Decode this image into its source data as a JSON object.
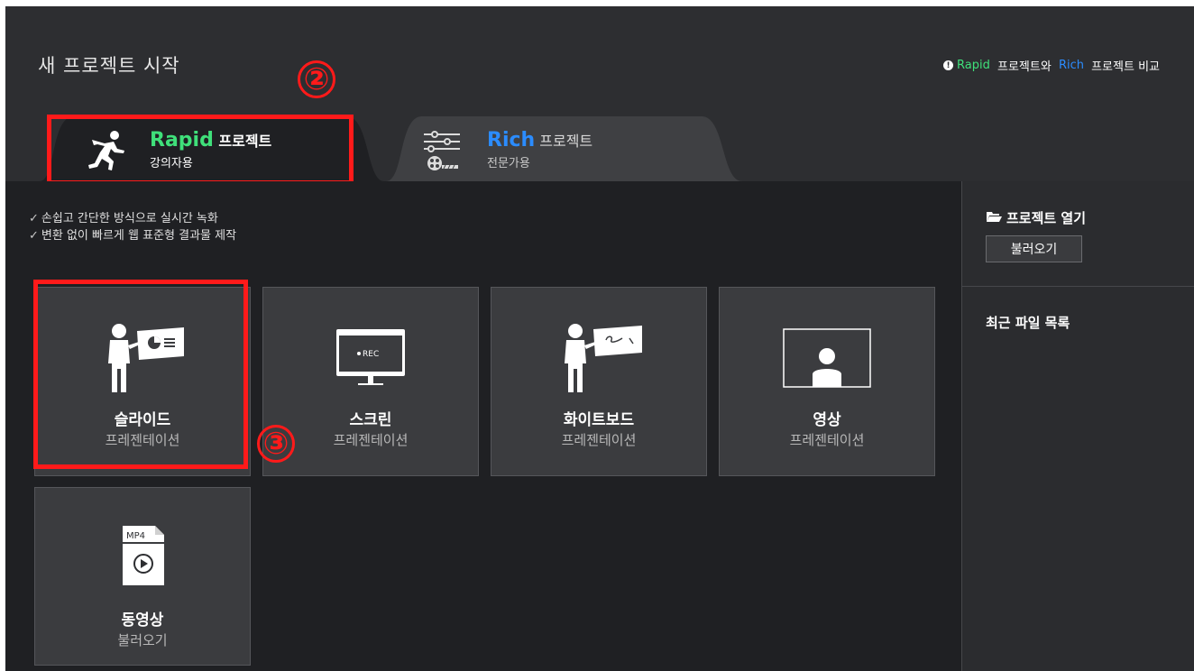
{
  "title": "새 프로젝트 시작",
  "compare": {
    "rapid": "Rapid",
    "mid": " 프로젝트와 ",
    "rich": "Rich",
    "tail": " 프로젝트 비교"
  },
  "tabs": {
    "rapid": {
      "name": "Rapid",
      "suffix": " 프로젝트",
      "sub": "강의자용"
    },
    "rich": {
      "name": "Rich",
      "suffix": " 프로젝트",
      "sub": "전문가용"
    }
  },
  "features": [
    "손쉽고 간단한 방식으로 실시간 녹화",
    "변환 없이 빠르게 웹 표준형 결과물 제작"
  ],
  "cards": [
    {
      "title": "슬라이드",
      "sub": "프레젠테이션",
      "icon": "presenter-slide-icon"
    },
    {
      "title": "스크린",
      "sub": "프레젠테이션",
      "icon": "monitor-rec-icon",
      "rec_label": "REC"
    },
    {
      "title": "화이트보드",
      "sub": "프레젠테이션",
      "icon": "presenter-whiteboard-icon"
    },
    {
      "title": "영상",
      "sub": "프레젠테이션",
      "icon": "video-person-icon"
    },
    {
      "title": "동영상",
      "sub": "불러오기",
      "icon": "mp4-file-icon",
      "file_label": "MP4"
    }
  ],
  "sidebar": {
    "open_title": "프로젝트 열기",
    "open_button": "불러오기",
    "recent_title": "최근 파일 목록"
  },
  "annotations": {
    "marker2": "②",
    "marker3": "③"
  },
  "colors": {
    "rapid_green": "#3fe07a",
    "rich_blue": "#2b8cff",
    "highlight_red": "#ff1a1a"
  }
}
